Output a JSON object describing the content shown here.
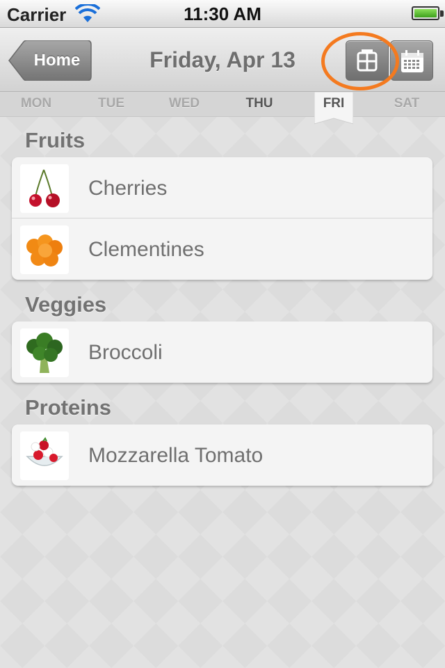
{
  "status_bar": {
    "carrier": "Carrier",
    "time": "11:30 AM"
  },
  "nav": {
    "back_label": "Home",
    "title": "Friday, Apr 13",
    "view_buttons": [
      "table-view",
      "calendar-view"
    ]
  },
  "days": [
    "MON",
    "TUE",
    "WED",
    "THU",
    "FRI",
    "SAT"
  ],
  "selected_day": "FRI",
  "sections": [
    {
      "title": "Fruits",
      "items": [
        {
          "label": "Cherries",
          "icon": "cherries-icon"
        },
        {
          "label": "Clementines",
          "icon": "clementines-icon"
        }
      ]
    },
    {
      "title": "Veggies",
      "items": [
        {
          "label": "Broccoli",
          "icon": "broccoli-icon"
        }
      ]
    },
    {
      "title": "Proteins",
      "items": [
        {
          "label": "Mozzarella Tomato",
          "icon": "mozzarella-tomato-icon"
        }
      ]
    }
  ],
  "colors": {
    "highlight": "#f47a1f",
    "nav_button": "#8a8a8a",
    "text": "#6f6f6f"
  }
}
